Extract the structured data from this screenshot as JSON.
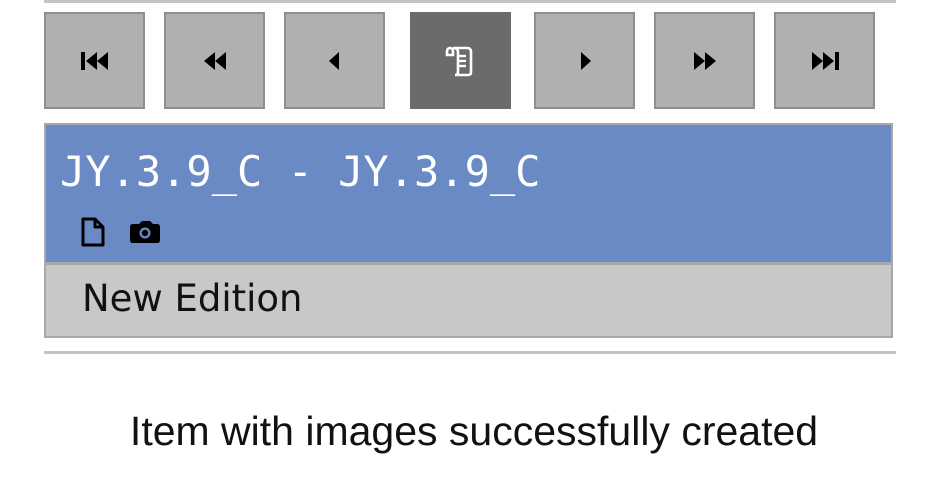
{
  "navigation": {
    "buttons": [
      {
        "name": "first",
        "icon": "skip-to-first-icon",
        "active": false
      },
      {
        "name": "fast-back",
        "icon": "fast-rewind-icon",
        "active": false
      },
      {
        "name": "back",
        "icon": "previous-icon",
        "active": false
      },
      {
        "name": "edition",
        "icon": "scroll-document-icon",
        "active": true
      },
      {
        "name": "forward",
        "icon": "next-icon",
        "active": false
      },
      {
        "name": "fast-forward",
        "icon": "fast-forward-icon",
        "active": false
      },
      {
        "name": "last",
        "icon": "skip-to-last-icon",
        "active": false
      }
    ]
  },
  "item": {
    "title": "JY.3.9_C - JY.3.9_C",
    "icons": [
      "document-icon",
      "camera-icon"
    ],
    "edition_label": "New Edition"
  },
  "colors": {
    "header_blue": "#6a8ac6",
    "button_gray": "#b0b0b0",
    "button_active": "#6b6b6b",
    "sub_gray": "#c8c8c8"
  },
  "status": {
    "message": "Item with images successfully created"
  }
}
